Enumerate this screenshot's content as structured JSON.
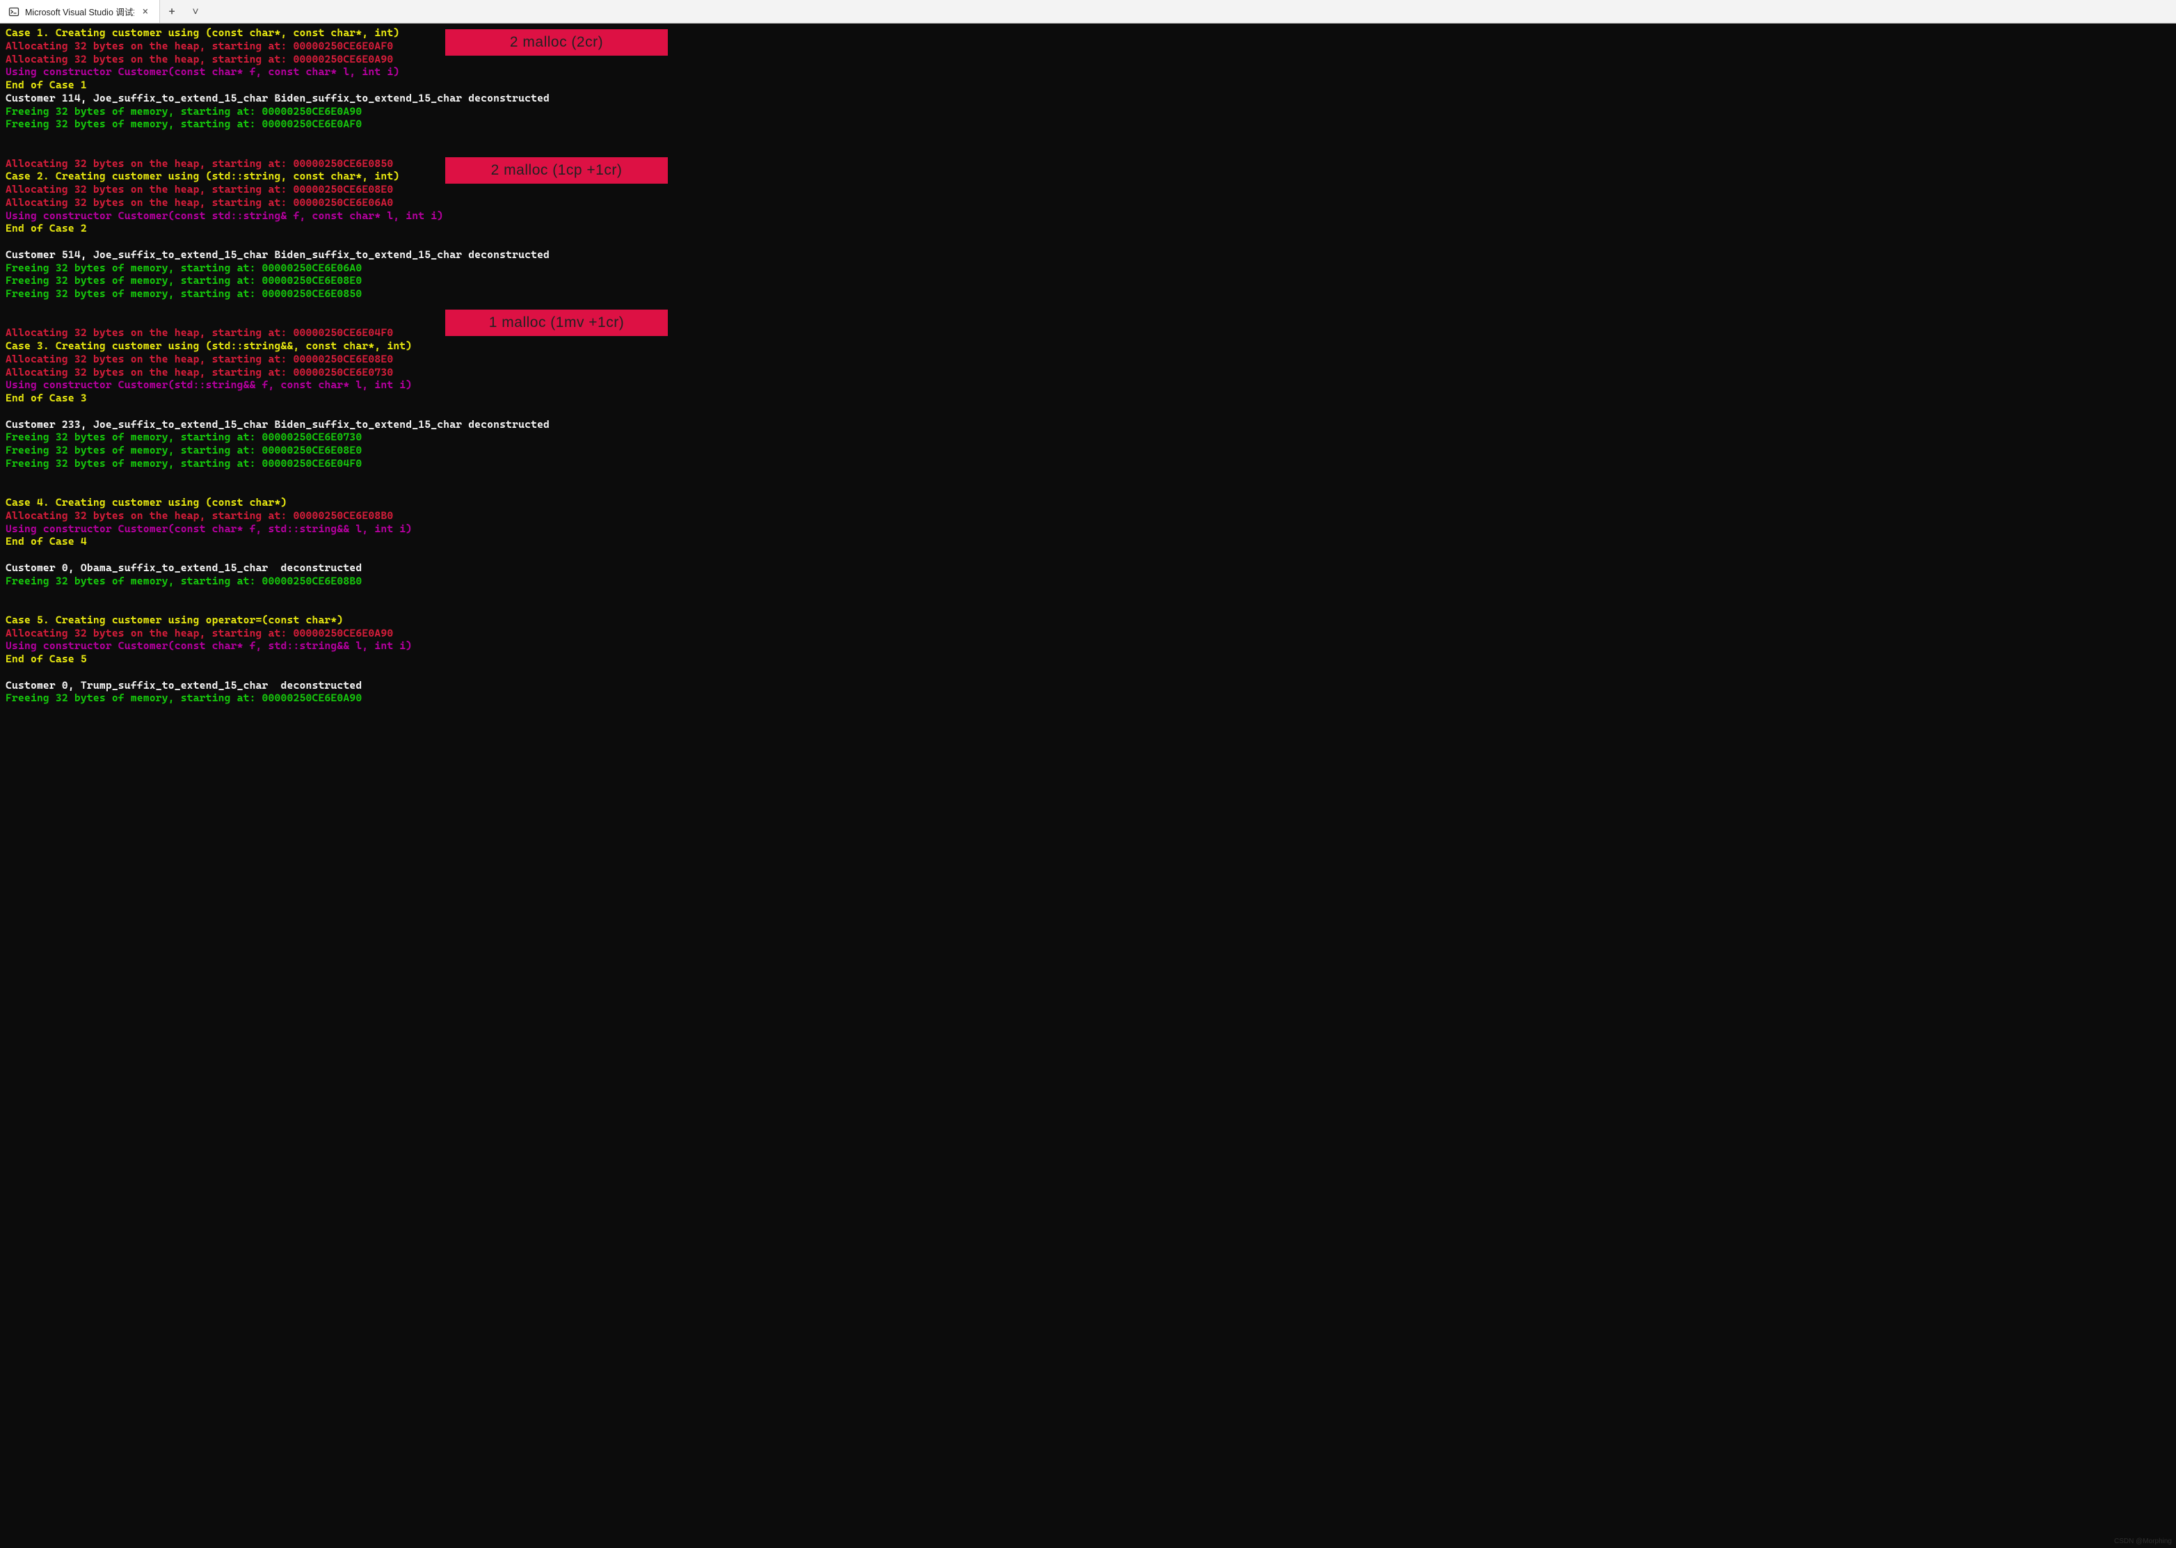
{
  "titlebar": {
    "tab_title": "Microsoft Visual Studio 调试控",
    "add_tab_label": "+",
    "dropdown_label": "˅",
    "close_tab_label": "×"
  },
  "overlays": {
    "case1": "2 malloc (2cr)",
    "case2": "2 malloc (1cp +1cr)",
    "case3": "1 malloc (1mv +1cr)"
  },
  "console": {
    "lines": [
      {
        "cls": "c-yellow",
        "t": "Case 1. Creating customer using (const char*, const char*, int)"
      },
      {
        "cls": "c-crimson",
        "t": "Allocating 32 bytes on the heap, starting at: 00000250CE6E0AF0"
      },
      {
        "cls": "c-crimson",
        "t": "Allocating 32 bytes on the heap, starting at: 00000250CE6E0A90"
      },
      {
        "cls": "c-magenta",
        "t": "Using constructor Customer(const char* f, const char* l, int i)"
      },
      {
        "cls": "c-yellow",
        "t": "End of Case 1"
      },
      {
        "cls": "c-white",
        "t": "Customer 114, Joe_suffix_to_extend_15_char Biden_suffix_to_extend_15_char deconstructed"
      },
      {
        "cls": "c-green",
        "t": "Freeing 32 bytes of memory, starting at: 00000250CE6E0A90"
      },
      {
        "cls": "c-green",
        "t": "Freeing 32 bytes of memory, starting at: 00000250CE6E0AF0"
      },
      {
        "blank": true
      },
      {
        "blank": true
      },
      {
        "cls": "c-crimson",
        "t": "Allocating 32 bytes on the heap, starting at: 00000250CE6E0850"
      },
      {
        "cls": "c-yellow",
        "t": "Case 2. Creating customer using (std::string, const char*, int)"
      },
      {
        "cls": "c-crimson",
        "t": "Allocating 32 bytes on the heap, starting at: 00000250CE6E08E0"
      },
      {
        "cls": "c-crimson",
        "t": "Allocating 32 bytes on the heap, starting at: 00000250CE6E06A0"
      },
      {
        "cls": "c-magenta",
        "t": "Using constructor Customer(const std::string& f, const char* l, int i)"
      },
      {
        "cls": "c-yellow",
        "t": "End of Case 2"
      },
      {
        "blank": true
      },
      {
        "cls": "c-white",
        "t": "Customer 514, Joe_suffix_to_extend_15_char Biden_suffix_to_extend_15_char deconstructed"
      },
      {
        "cls": "c-green",
        "t": "Freeing 32 bytes of memory, starting at: 00000250CE6E06A0"
      },
      {
        "cls": "c-green",
        "t": "Freeing 32 bytes of memory, starting at: 00000250CE6E08E0"
      },
      {
        "cls": "c-green",
        "t": "Freeing 32 bytes of memory, starting at: 00000250CE6E0850"
      },
      {
        "blank": true
      },
      {
        "blank": true
      },
      {
        "cls": "c-crimson",
        "t": "Allocating 32 bytes on the heap, starting at: 00000250CE6E04F0"
      },
      {
        "cls": "c-yellow",
        "t": "Case 3. Creating customer using (std::string&&, const char*, int)"
      },
      {
        "cls": "c-crimson",
        "t": "Allocating 32 bytes on the heap, starting at: 00000250CE6E08E0"
      },
      {
        "cls": "c-crimson",
        "t": "Allocating 32 bytes on the heap, starting at: 00000250CE6E0730"
      },
      {
        "cls": "c-magenta",
        "t": "Using constructor Customer(std::string&& f, const char* l, int i)"
      },
      {
        "cls": "c-yellow",
        "t": "End of Case 3"
      },
      {
        "blank": true
      },
      {
        "cls": "c-white",
        "t": "Customer 233, Joe_suffix_to_extend_15_char Biden_suffix_to_extend_15_char deconstructed"
      },
      {
        "cls": "c-green",
        "t": "Freeing 32 bytes of memory, starting at: 00000250CE6E0730"
      },
      {
        "cls": "c-green",
        "t": "Freeing 32 bytes of memory, starting at: 00000250CE6E08E0"
      },
      {
        "cls": "c-green",
        "t": "Freeing 32 bytes of memory, starting at: 00000250CE6E04F0"
      },
      {
        "blank": true
      },
      {
        "blank": true
      },
      {
        "cls": "c-yellow",
        "t": "Case 4. Creating customer using (const char*)"
      },
      {
        "cls": "c-crimson",
        "t": "Allocating 32 bytes on the heap, starting at: 00000250CE6E08B0"
      },
      {
        "cls": "c-magenta",
        "t": "Using constructor Customer(const char* f, std::string&& l, int i)"
      },
      {
        "cls": "c-yellow",
        "t": "End of Case 4"
      },
      {
        "blank": true
      },
      {
        "cls": "c-white",
        "t": "Customer 0, Obama_suffix_to_extend_15_char  deconstructed"
      },
      {
        "cls": "c-green",
        "t": "Freeing 32 bytes of memory, starting at: 00000250CE6E08B0"
      },
      {
        "blank": true
      },
      {
        "blank": true
      },
      {
        "cls": "c-yellow",
        "t": "Case 5. Creating customer using operator=(const char*)"
      },
      {
        "cls": "c-crimson",
        "t": "Allocating 32 bytes on the heap, starting at: 00000250CE6E0A90"
      },
      {
        "cls": "c-magenta",
        "t": "Using constructor Customer(const char* f, std::string&& l, int i)"
      },
      {
        "cls": "c-yellow",
        "t": "End of Case 5"
      },
      {
        "blank": true
      },
      {
        "cls": "c-white",
        "t": "Customer 0, Trump_suffix_to_extend_15_char  deconstructed"
      },
      {
        "cls": "c-green",
        "t": "Freeing 32 bytes of memory, starting at: 00000250CE6E0A90"
      }
    ]
  },
  "watermark": "CSDN @Morphing"
}
